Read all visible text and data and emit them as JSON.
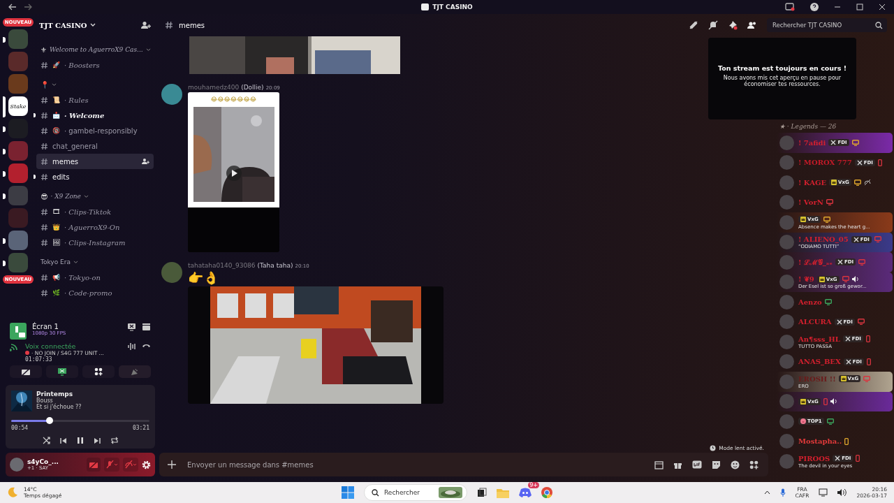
{
  "titlebar": {
    "title": "TJT CASINO"
  },
  "servers": [
    {
      "kind": "badge",
      "label": "NOUVEAU"
    },
    {
      "kind": "avatar",
      "unread": true,
      "selected": false
    },
    {
      "kind": "avatar",
      "unread": false,
      "selected": false
    },
    {
      "kind": "avatar",
      "unread": false,
      "selected": false
    },
    {
      "kind": "logo",
      "label": "Stake",
      "unread": false,
      "selected": true
    },
    {
      "kind": "avatar",
      "unread": true,
      "selected": false
    },
    {
      "kind": "avatar",
      "unread": true,
      "selected": false
    },
    {
      "kind": "avatar",
      "unread": true,
      "selected": false
    },
    {
      "kind": "avatar",
      "unread": true,
      "selected": false
    },
    {
      "kind": "avatar",
      "unread": false,
      "selected": false
    },
    {
      "kind": "avatar",
      "unread": true,
      "selected": false
    },
    {
      "kind": "avatar",
      "unread": true,
      "selected": false
    },
    {
      "kind": "badge",
      "label": "NOUVEAU"
    }
  ],
  "server_header": {
    "name": "TJT CASINO"
  },
  "channel_groups": [
    {
      "kind": "fancy",
      "name": "Welcome to AguerroX9 Cas...",
      "emoji": "⚜",
      "channels": [
        {
          "kind": "fancy",
          "emoji": "🚀",
          "name": "· Boosters",
          "unread": false,
          "selected": false
        }
      ]
    },
    {
      "kind": "fancy",
      "emoji": "📍",
      "channels": [
        {
          "kind": "fancy",
          "emoji": "📜",
          "name": "· Rules",
          "unread": false,
          "selected": false
        },
        {
          "kind": "fancy",
          "emoji": "📩",
          "name": "· Welcome",
          "unread": true,
          "selected": false
        },
        {
          "kind": "emoji",
          "emoji": "🔞",
          "name": "· gambel-responsibly",
          "unread": false,
          "selected": false
        },
        {
          "kind": "plain",
          "name": "chat_general",
          "unread": false,
          "selected": false
        },
        {
          "kind": "plain",
          "name": "memes",
          "unread": false,
          "selected": true
        },
        {
          "kind": "plain",
          "name": "edits",
          "unread": true,
          "selected": false
        }
      ]
    },
    {
      "kind": "fancy",
      "name": "· X9 Zone",
      "emoji": "😎",
      "channels": [
        {
          "kind": "fancy",
          "emoji": "🎞",
          "name": "· Clips-Tiktok",
          "unread": false,
          "selected": false
        },
        {
          "kind": "fancy",
          "emoji": "👑",
          "name": "· AguerroX9-On",
          "unread": false,
          "selected": false
        },
        {
          "kind": "fancy",
          "emoji": "🖼",
          "name": "· Clips-Instagram",
          "unread": false,
          "selected": false
        }
      ]
    },
    {
      "kind": "plain",
      "name": "Tokyo Era",
      "channels": [
        {
          "kind": "fancy",
          "emoji": "📢",
          "name": "· Tokyo-on",
          "unread": false,
          "selected": false
        },
        {
          "kind": "fancy",
          "emoji": "🌿",
          "name": "· Code-promo",
          "unread": false,
          "selected": false
        }
      ]
    }
  ],
  "stream": {
    "title": "Écran 1",
    "quality": "1080p 30 FPS"
  },
  "voice": {
    "status": "Voix connectée",
    "channel": "· NO JOIN / S4G 777 UNIT ...",
    "elapsed": "01:07:33"
  },
  "music": {
    "title": "Printemps",
    "artist": "Bouss",
    "track": "Et si j'échoue ??",
    "level": 0.28,
    "elapsed": "00:54",
    "duration": "03:21"
  },
  "user": {
    "name": "s4yCo_...",
    "extra": "+1 ·",
    "status": "SAY"
  },
  "channel_header": {
    "name": "memes",
    "search_placeholder": "Rechercher TJT CASINO"
  },
  "messages": [
    {
      "kind": "media_tail"
    },
    {
      "kind": "embed",
      "author": "mouhamedz400",
      "nick": "(Dollie)",
      "time": "20:09",
      "caption": "😂😂😂😂😂😂😂"
    },
    {
      "kind": "video",
      "author": "tahataha0140_93086",
      "nick": "(Taha taha)",
      "time": "20:10",
      "text": "👉👌"
    }
  ],
  "stream_notice": {
    "title": "Ton stream est toujours en cours !",
    "body": "Nous avons mis cet aperçu en pause pour économiser tes ressources."
  },
  "composer": {
    "slowmode": "Mode lent activé.",
    "placeholder": "Envoyer un message dans #memes"
  },
  "members": {
    "group": "★ · Legends — 26",
    "items": [
      {
        "name": "! 7afidi",
        "color": "#d4202e",
        "tag": {
          "kind": "sword",
          "label": "FDI"
        },
        "device": {
          "kind": "desktop",
          "color": "#e0a82e"
        },
        "nameplate": {
          "color": "#7a2aa8"
        }
      },
      {
        "name": "! MOROX 777",
        "color": "#c41a28",
        "tag": {
          "kind": "sword",
          "label": "FDI"
        },
        "device": {
          "kind": "mobile",
          "color": "#d9343f"
        }
      },
      {
        "name": "! KAGE",
        "color": "#d4202e",
        "tag": {
          "kind": "crown",
          "label": "VxG"
        },
        "device": {
          "kind": "desktop",
          "color": "#e0a82e"
        },
        "activity": {
          "kind": "muted"
        }
      },
      {
        "name": "! VorN",
        "color": "#d4202e",
        "device": {
          "kind": "desktop",
          "color": "#d9343f"
        }
      },
      {
        "tag": {
          "kind": "crown",
          "label": "VxG"
        },
        "device": {
          "kind": "desktop",
          "color": "#e0a82e"
        },
        "status": "Absence makes the heart g...",
        "nameplate": {
          "color": "#8a3a1a"
        }
      },
      {
        "name": "! ALIENO_05",
        "color": "#d4202e",
        "tag": {
          "kind": "sword",
          "label": "FDI"
        },
        "device": {
          "kind": "desktop",
          "color": "#d9343f"
        },
        "status": "“ODIAMO TUTTI”",
        "nameplate": {
          "color": "#3a3a8a"
        }
      },
      {
        "name": "! ℒℳ𝒢_ₐₑ",
        "color": "#d4202e",
        "tag": {
          "kind": "sword",
          "label": "FDI"
        },
        "device": {
          "kind": "desktop",
          "color": "#d9343f"
        },
        "nameplate": {
          "color": "#5a2a7a"
        }
      },
      {
        "name": "! ❦9",
        "color": "#d4202e",
        "tag": {
          "kind": "crown",
          "label": "VxG"
        },
        "device": {
          "kind": "desktop",
          "color": "#d9343f"
        },
        "activity": {
          "kind": "speaker"
        },
        "status": "Der Esel ist so groß gewor...",
        "nameplate": {
          "color": "#5a2a7a"
        }
      },
      {
        "name": "Aenzo",
        "color": "#d4202e",
        "device": {
          "kind": "desktop",
          "color": "#3ba55d"
        }
      },
      {
        "name": "ALCURA",
        "color": "#d4202e",
        "tag": {
          "kind": "sword",
          "label": "FDI"
        },
        "device": {
          "kind": "desktop",
          "color": "#d9343f"
        }
      },
      {
        "name": "An¶sss_HL",
        "color": "#d4202e",
        "tag": {
          "kind": "sword",
          "label": "FDI"
        },
        "device": {
          "kind": "mobile",
          "color": "#d9343f"
        },
        "status": "TUTTO PASSA"
      },
      {
        "name": "ANAS_BEX",
        "color": "#d4202e",
        "tag": {
          "kind": "sword",
          "label": "FDI"
        },
        "device": {
          "kind": "mobile",
          "color": "#d9343f"
        }
      },
      {
        "name": "EROSH !!",
        "color": "#6a1a1a",
        "tag": {
          "kind": "crown",
          "label": "VxG"
        },
        "device": {
          "kind": "desktop",
          "color": "#d9343f"
        },
        "status": "ERO",
        "nameplate": {
          "color": "#b0a490"
        }
      },
      {
        "tag": {
          "kind": "crown",
          "label": "VxG"
        },
        "device": {
          "kind": "mobile",
          "color": "#d9343f"
        },
        "activity": {
          "kind": "speaker"
        },
        "nameplate": {
          "color": "#6a2a9a"
        }
      },
      {
        "tag": {
          "kind": "pig",
          "label": "TOP1"
        },
        "device": {
          "kind": "desktop",
          "color": "#3ba55d"
        }
      },
      {
        "name": "Mostapha..",
        "color": "#e23a3a",
        "device": {
          "kind": "mobile",
          "color": "#e0a82e"
        }
      },
      {
        "name": "PIROOS",
        "color": "#d4202e",
        "tag": {
          "kind": "sword",
          "label": "FDI"
        },
        "device": {
          "kind": "mobile",
          "color": "#d9343f"
        },
        "status": "The devil in your eyes"
      }
    ]
  },
  "taskbar": {
    "temperature": "14°C",
    "weather": "Temps dégagé",
    "search_placeholder": "Rechercher",
    "chat_badge": "9+",
    "language": "FRA",
    "layout": "CAFR",
    "time": "20:16",
    "date": "2026-03-17"
  }
}
